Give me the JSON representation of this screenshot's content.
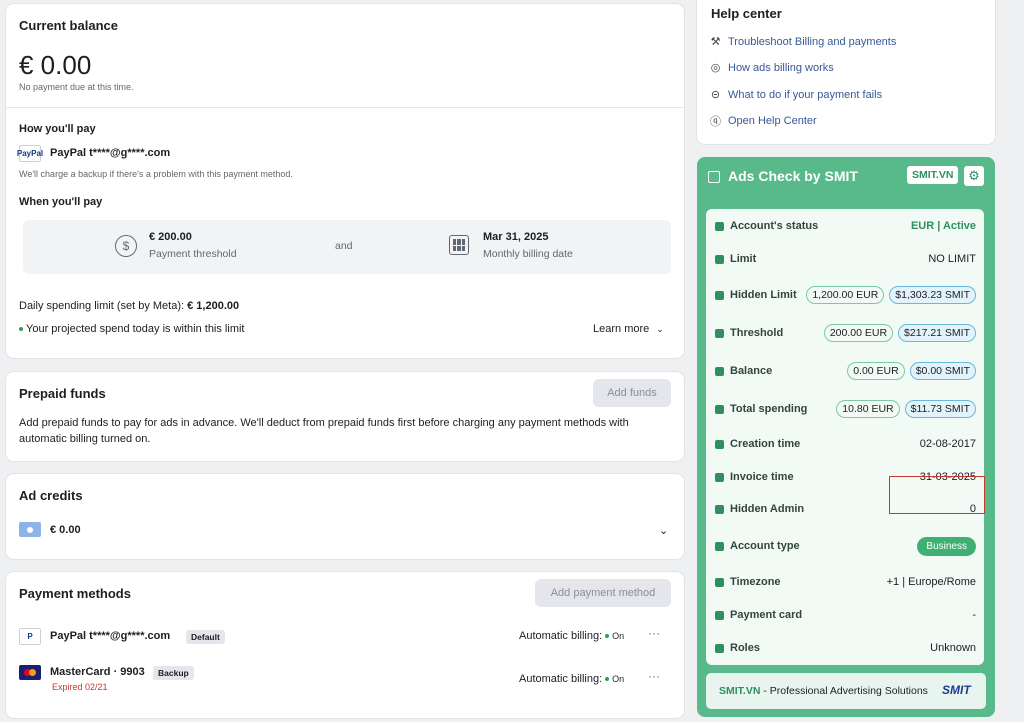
{
  "balance": {
    "title": "Current balance",
    "amount": "€ 0.00",
    "note": "No payment due at this time.",
    "how_title": "How you'll pay",
    "paypal_logo": "PayPal",
    "paypal_account": "PayPal t****@g****.com",
    "backup_note": "We'll charge a backup if there's a problem with this payment method.",
    "when_title": "When you'll pay",
    "threshold_amount": "€ 200.00",
    "threshold_label": "Payment threshold",
    "and": "and",
    "date_amount": "Mar 31, 2025",
    "date_label": "Monthly billing date",
    "daily_limit_prefix": "Daily spending limit (set by Meta): ",
    "daily_limit_value": "€ 1,200.00",
    "projected": "Your projected spend today is within this limit",
    "learn_more": "Learn more"
  },
  "prepaid": {
    "title": "Prepaid funds",
    "button": "Add funds",
    "description": "Add prepaid funds to pay for ads in advance. We'll deduct from prepaid funds first before charging any payment methods with automatic billing turned on."
  },
  "credits": {
    "title": "Ad credits",
    "amount": "€ 0.00"
  },
  "payment_methods": {
    "title": "Payment methods",
    "button": "Add payment method",
    "items": [
      {
        "name": "PayPal t****@g****.com",
        "tag": "Default",
        "billing": "Automatic billing:",
        "state": "On"
      },
      {
        "name": "MasterCard · 9903",
        "tag": "Backup",
        "expired": "Expired 02/21",
        "billing": "Automatic billing:",
        "state": "On"
      }
    ]
  },
  "help": {
    "title": "Help center",
    "links": [
      "Troubleshoot Billing and payments",
      "How ads billing works",
      "What to do if your payment fails",
      "Open Help Center"
    ]
  },
  "smit": {
    "title": "Ads Check by SMIT",
    "badge": "SMIT.VN",
    "rows": {
      "status": {
        "label": "Account's status",
        "value": "EUR | Active"
      },
      "limit": {
        "label": "Limit",
        "value": "NO LIMIT"
      },
      "hidden_limit": {
        "label": "Hidden Limit",
        "eur": "1,200.00 EUR",
        "smit": "$1,303.23 SMIT"
      },
      "threshold": {
        "label": "Threshold",
        "eur": "200.00 EUR",
        "smit": "$217.21 SMIT"
      },
      "balance": {
        "label": "Balance",
        "eur": "0.00 EUR",
        "smit": "$0.00 SMIT"
      },
      "total": {
        "label": "Total spending",
        "eur": "10.80 EUR",
        "smit": "$11.73 SMIT"
      },
      "creation": {
        "label": "Creation time",
        "value": "02-08-2017"
      },
      "invoice": {
        "label": "Invoice time",
        "value": "31-03-2025"
      },
      "admin": {
        "label": "Hidden Admin",
        "value": "0"
      },
      "type": {
        "label": "Account type",
        "value": "Business"
      },
      "timezone": {
        "label": "Timezone",
        "value": "+1 | Europe/Rome"
      },
      "card": {
        "label": "Payment card",
        "value": "-"
      },
      "roles": {
        "label": "Roles",
        "value": "Unknown"
      }
    },
    "footer_brand": "SMIT.VN",
    "footer_text": " - Professional Advertising Solutions",
    "footer_logo": "SMIT"
  },
  "colors": {
    "accent": "#58b98a",
    "active": "#2f8f5e",
    "link": "#385898",
    "highlight_box": "#c0392b"
  }
}
